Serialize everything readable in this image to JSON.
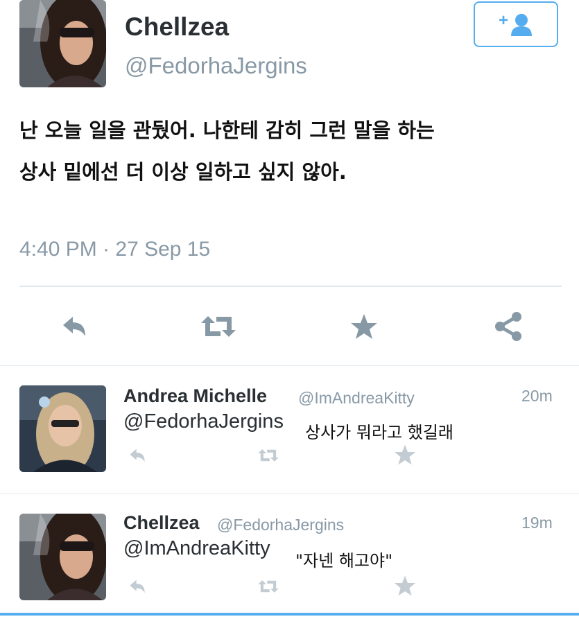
{
  "tweet": {
    "display_name": "Chellzea",
    "handle": "@FedorhaJergins",
    "text_line1": "난 오늘 일을 관뒀어. 나한테 감히 그런 말을 하는",
    "text_line2": "상사 밑에선 더 이상 일하고 싶지 않아.",
    "timestamp": "4:40 PM · 27 Sep 15",
    "follow_icon_text": "+"
  },
  "actions": [
    "reply-icon",
    "retweet-icon",
    "favorite-icon",
    "share-icon"
  ],
  "replies": [
    {
      "display_name": "Andrea Michelle",
      "handle": "@ImAndreaKitty",
      "time": "20m",
      "mention": "@FedorhaJergins",
      "text": "상사가 뭐라고 했길래"
    },
    {
      "display_name": "Chellzea",
      "handle": "@FedorhaJergins",
      "time": "19m",
      "mention": "@ImAndreaKitty",
      "text": "\"자넨 해고야\""
    }
  ],
  "colors": {
    "accent": "#55acee",
    "icon_gray": "#8899a6",
    "faint_icon": "#c3ccd3",
    "divider": "#e1e8ed"
  }
}
